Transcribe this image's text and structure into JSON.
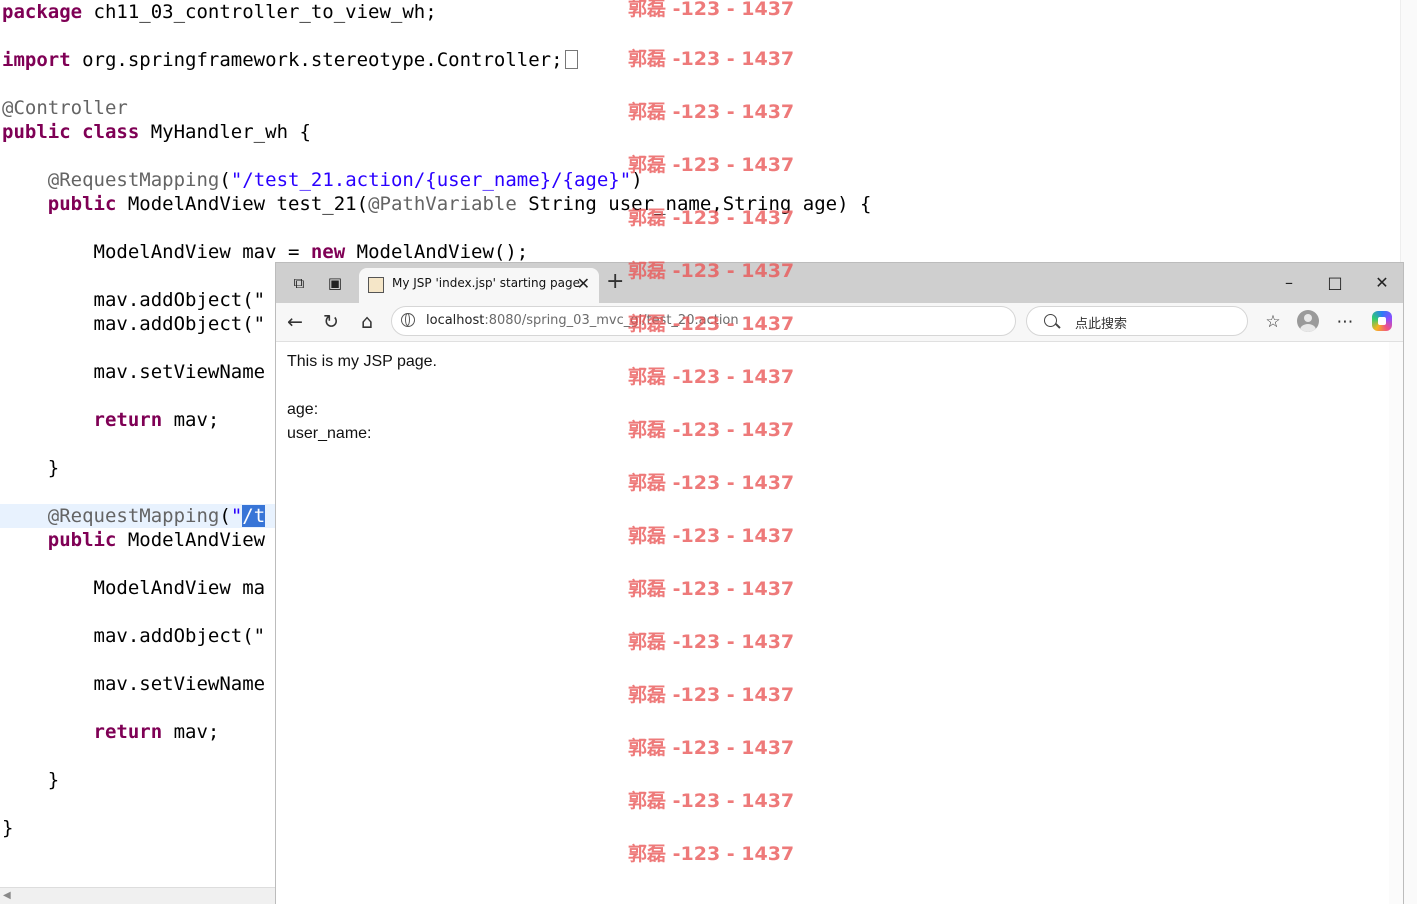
{
  "editor": {
    "line_package": "package ch11_03_controller_to_view_wh;",
    "kw_import": "import",
    "import_rest": " org.springframework.stereotype.Controller;",
    "ann_controller": "@Controller",
    "kw_public": "public",
    "kw_class": "class",
    "class_rest": " MyHandler_wh {",
    "ann_request_mapping": "@RequestMapping",
    "paren_open_quote": "(",
    "mapping1_string": "\"/test_21.action/{user_name}/{age}\"",
    "mapping1_close": ")",
    "method1_a": " ModelAndView test_21(",
    "ann_path_variable": "@PathVariable",
    "method1_b": " String user_name,String age) {",
    "mav_decl_a": "ModelAndView mav = ",
    "kw_new": "new",
    "mav_decl_b": " ModelAndView();",
    "add_object_partial": "mav.addObject(\"",
    "set_view_partial": "mav.setViewName",
    "kw_return": "return",
    "return_rest": " mav;",
    "close_brace": "}",
    "mapping2_quote": "\"",
    "mapping2_selected": "/t",
    "method2_partial": " ModelAndView",
    "mav_decl2_partial": "ModelAndView ma"
  },
  "browser": {
    "tab_title": "My JSP 'index.jsp' starting page",
    "url_host": "localhost",
    "url_rest": ":8080/spring_03_mvc_gl/test_20.action",
    "search_placeholder": "点此搜索",
    "page_heading": "This is my JSP page.",
    "age_label": "age:",
    "user_name_label": "user_name:"
  },
  "icons": {
    "workspaces": "workspaces-icon",
    "tab_actions": "tab-actions-icon",
    "back": "back-icon",
    "refresh": "refresh-icon",
    "home": "home-icon",
    "favorites": "favorites-icon",
    "more": "more-icon"
  },
  "watermark": {
    "text": "郭磊 -123 - 1437"
  },
  "colors": {
    "keyword": "#7f0055",
    "annotation": "#646464",
    "string": "#2a00ff",
    "selection": "#3875d7",
    "watermark": "#e95454"
  }
}
